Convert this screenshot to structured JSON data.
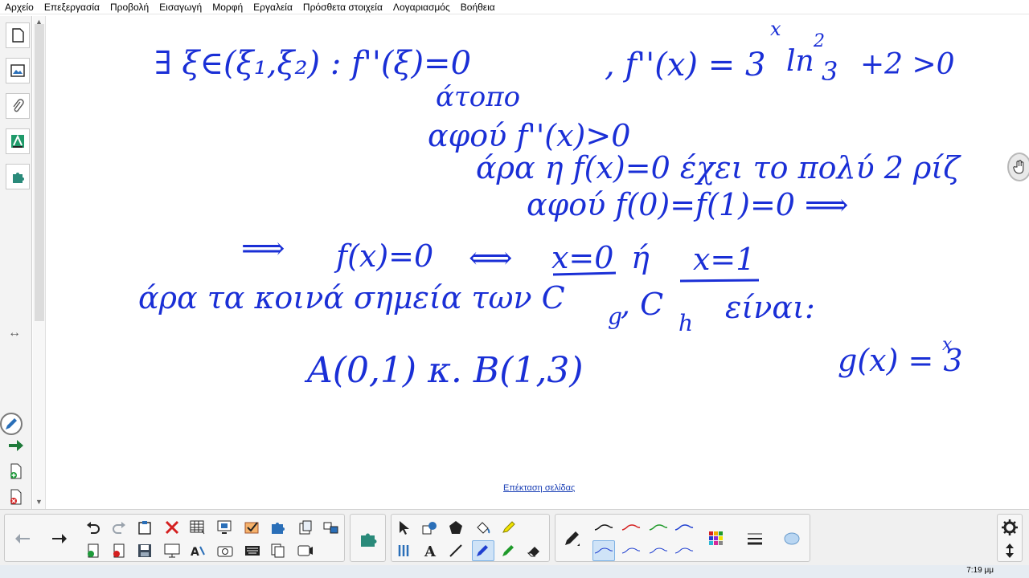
{
  "menu": [
    "Αρχείο",
    "Επεξεργασία",
    "Προβολή",
    "Εισαγωγή",
    "Μορφή",
    "Εργαλεία",
    "Πρόσθετα στοιχεία",
    "Λογαριασμός",
    "Βοήθεια"
  ],
  "canvas": {
    "extend_page_link": "Επέκταση σελίδας"
  },
  "handwriting": {
    "line1_left": "∃ ξ∈(ξ₁,ξ₂) : f''(ξ)=0",
    "line1_right": ", f''(x) = 3",
    "line1_exp": "x",
    "line1_ln": "ln",
    "line1_ln2": "2",
    "line1_three": "3",
    "line1_tail": "+2 >0",
    "line2": "άτοπο",
    "line3": "αφού f''(x)>0",
    "line4": "άρα η f(x)=0 έχει το πολύ 2 ρίζ",
    "line5": "αφού f(0)=f(1)=0 ⟹",
    "line6_arrow": "⟹",
    "line6_a": "f(x)=0",
    "line6_iff": "⟺",
    "line6_b": "x=0",
    "line6_or": "ή",
    "line6_c": "x=1",
    "line7": "άρα τα κοινά σημεία των C",
    "line7_g": "g",
    "line7_comma": ", C",
    "line7_h": "h",
    "line7_tail": "είναι:",
    "line8": "A(0,1) κ. B(1,3)",
    "line8_right": "g(x) = 3",
    "line8_exp": "x"
  },
  "status": {
    "clock": "7:19 μμ"
  },
  "colors": {
    "ink_blue": "#1a2fd6",
    "pen_black": "#111111",
    "pen_red": "#d42020",
    "pen_green": "#1f9a2a",
    "pen_blue": "#1f3fd0",
    "accent": "#1f6fb8"
  },
  "icons": {
    "side_tabs": [
      "page-sorter-icon",
      "gallery-icon",
      "attachments-icon",
      "properties-icon",
      "addons-icon"
    ],
    "toolbar": [
      "back-icon",
      "forward-icon",
      "undo-icon",
      "redo-icon",
      "paste-icon",
      "delete-icon",
      "table-icon",
      "screen-capture-icon",
      "response-icon",
      "addons-puzzle-icon",
      "clear-page-icon",
      "view-screens-icon",
      "select-icon",
      "shapes-icon",
      "regular-polygon-icon",
      "fill-icon",
      "highlighter-icon",
      "measurement-icon",
      "text-icon",
      "line-icon",
      "pen-icon",
      "creative-pen-icon",
      "eraser-icon",
      "pen-style-icon",
      "color-palette-icon",
      "line-width-icon",
      "fill-effects-icon",
      "settings-gear-icon",
      "move-toolbar-icon"
    ]
  }
}
